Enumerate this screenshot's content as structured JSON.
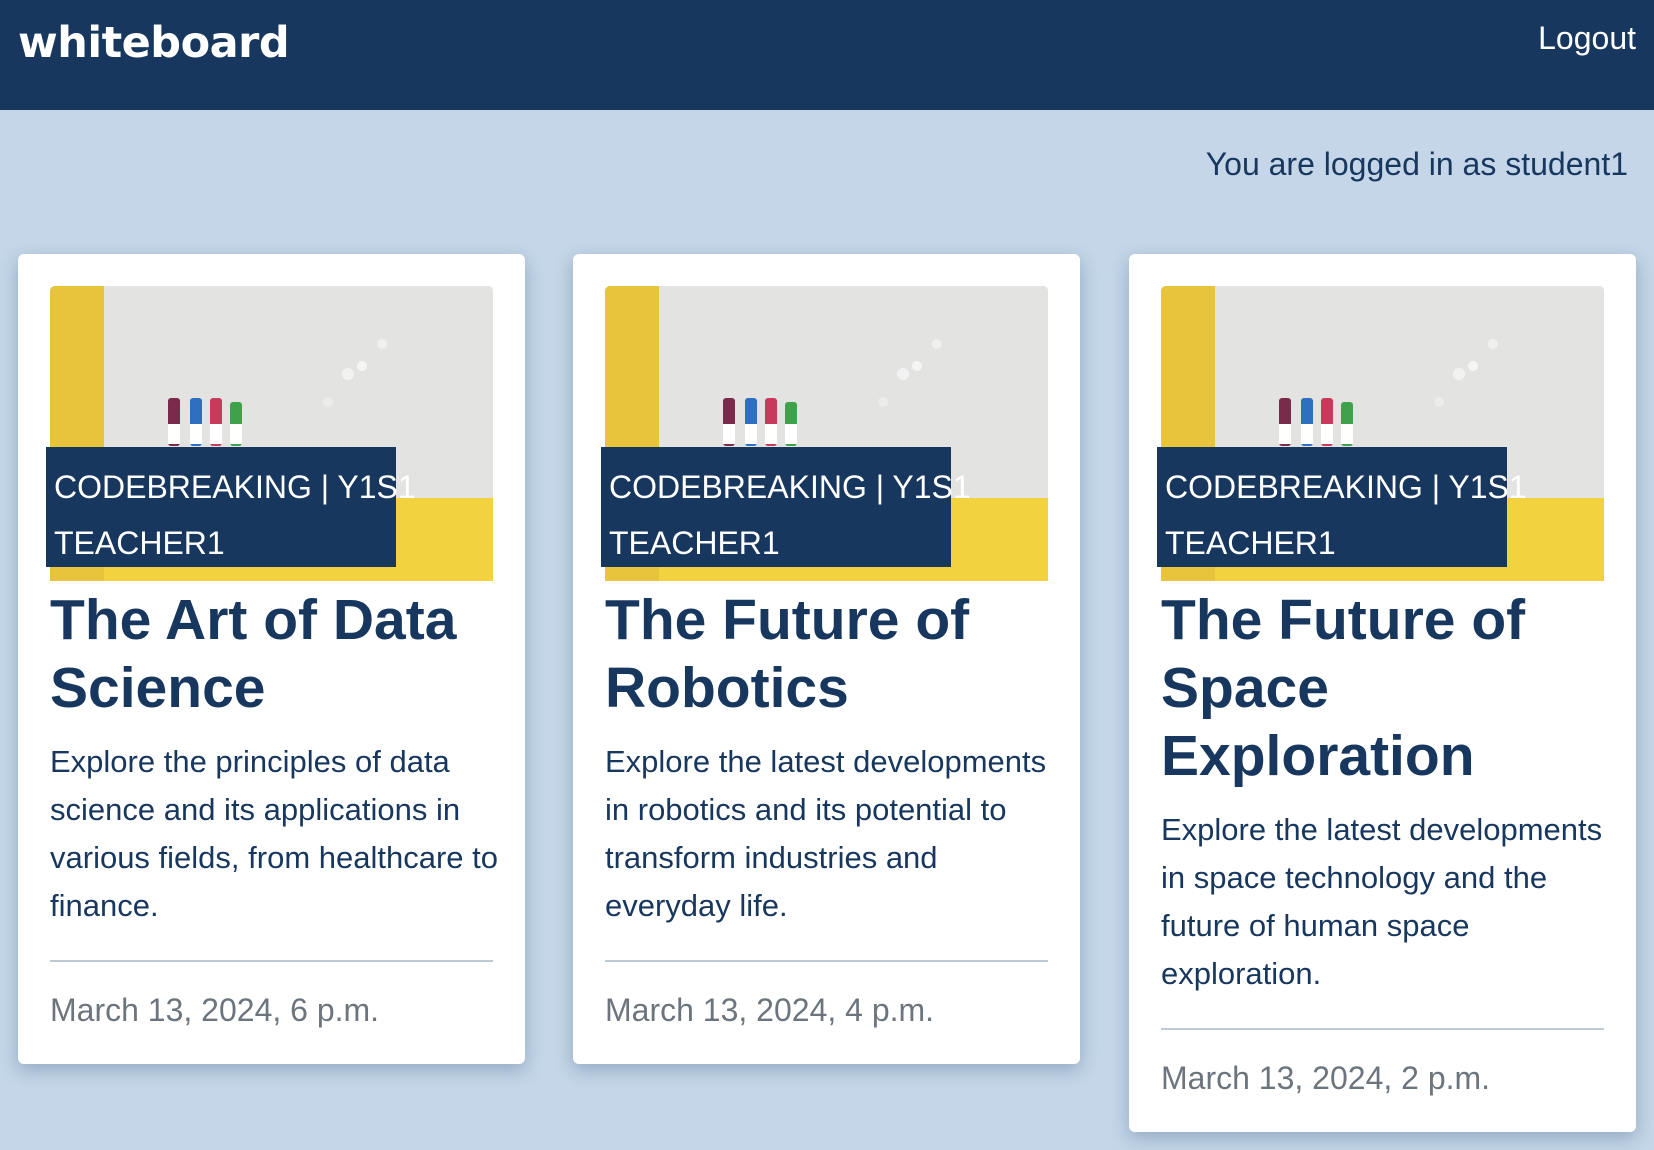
{
  "navbar": {
    "brand": "whiteboard",
    "logout_label": "Logout"
  },
  "status": {
    "logged_in_text": "You are logged in as student1"
  },
  "colors": {
    "navbar": "#17375e",
    "background": "#c4d6e8",
    "card": "#ffffff",
    "text": "#17375e",
    "muted": "#6c757d"
  },
  "cards": [
    {
      "course": "CODEBREAKING | Y1S1",
      "teacher": "TEACHER1",
      "title": "The Art of Data Science",
      "description": "Explore the principles of data science and its applications in various fields, from healthcare to finance.",
      "date": "March 13, 2024, 6 p.m.",
      "image": "whiteboard-markers-image"
    },
    {
      "course": "CODEBREAKING | Y1S1",
      "teacher": "TEACHER1",
      "title": "The Future of Robotics",
      "description": "Explore the latest developments in robotics and its potential to transform industries and everyday life.",
      "date": "March 13, 2024, 4 p.m.",
      "image": "whiteboard-markers-image"
    },
    {
      "course": "CODEBREAKING | Y1S1",
      "teacher": "TEACHER1",
      "title": "The Future of Space Exploration",
      "description": "Explore the latest developments in space technology and the future of human space exploration.",
      "date": "March 13, 2024, 2 p.m.",
      "image": "whiteboard-markers-image"
    }
  ]
}
